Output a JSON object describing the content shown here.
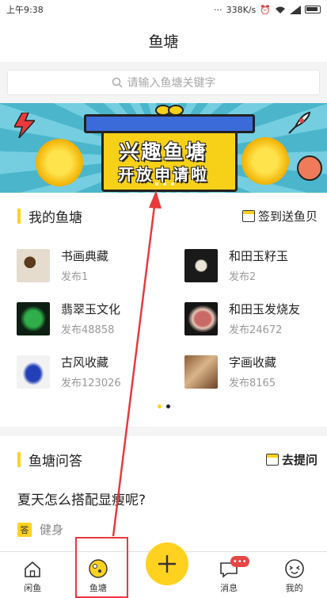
{
  "status_bar": {
    "time": "上午9:38",
    "dots": "···",
    "speed": "338K/s",
    "icons": [
      "alarm-icon",
      "wifi-icon",
      "signal-icon",
      "battery-icon"
    ]
  },
  "title": "鱼塘",
  "search": {
    "placeholder": "请输入鱼塘关键字",
    "icon": "search-icon"
  },
  "banner": {
    "line1": "兴趣鱼塘",
    "line2": "开放申请啦"
  },
  "my_ponds": {
    "title": "我的鱼塘",
    "signin_label": "签到送鱼贝",
    "items": [
      {
        "name": "书画典藏",
        "count": "发布1"
      },
      {
        "name": "和田玉籽玉",
        "count": "发布2"
      },
      {
        "name": "翡翠玉文化",
        "count": "发布48858"
      },
      {
        "name": "和田玉发烧友",
        "count": "发布24672"
      },
      {
        "name": "古风收藏",
        "count": "发布123026"
      },
      {
        "name": "字画收藏",
        "count": "发布8165"
      }
    ]
  },
  "qa": {
    "title": "鱼塘问答",
    "ask_label": "去提问",
    "question": "夏天怎么搭配显瘦呢?",
    "answer_badge": "答",
    "answer": "健身"
  },
  "tabbar": {
    "tabs": [
      {
        "label": "闲鱼",
        "icon": "home-icon"
      },
      {
        "label": "鱼塘",
        "icon": "pond-icon"
      },
      {
        "label": "",
        "icon": "plus-icon"
      },
      {
        "label": "消息",
        "icon": "message-icon"
      },
      {
        "label": "我的",
        "icon": "profile-face-icon"
      }
    ],
    "message_badge": "•••"
  },
  "colors": {
    "accent": "#ffd21f",
    "annotation": "#e8393b"
  }
}
